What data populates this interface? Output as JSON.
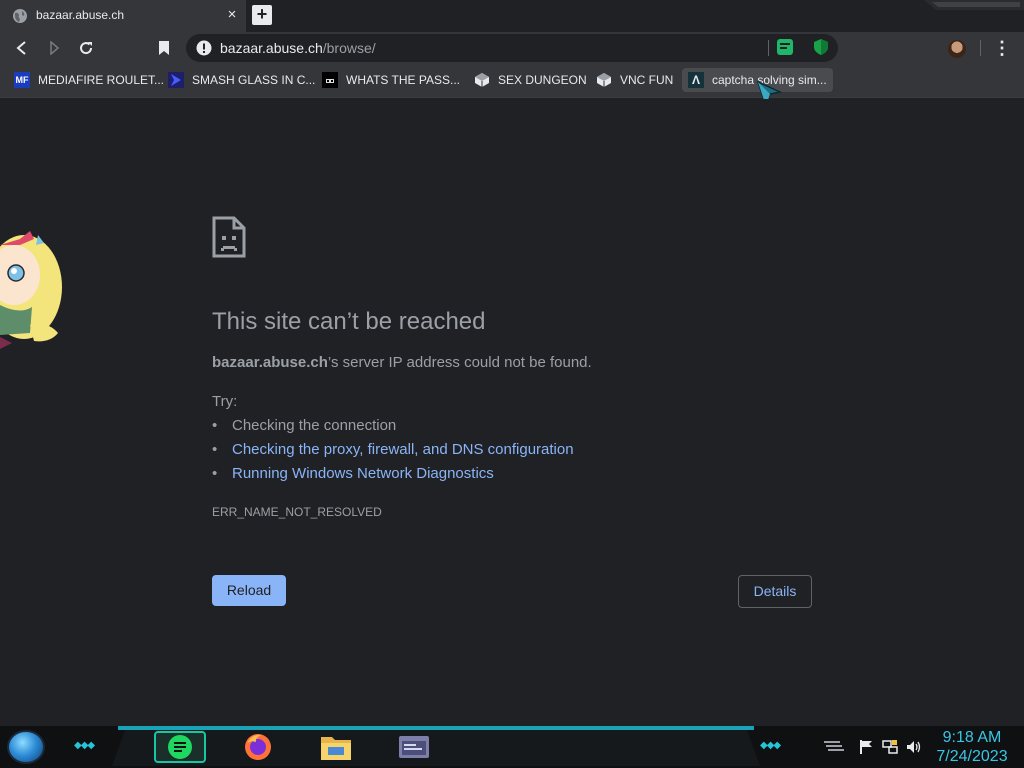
{
  "tab": {
    "title": "bazaar.abuse.ch",
    "close_glyph": "×",
    "new_tab_glyph": "+"
  },
  "toolbar": {
    "url_host": "bazaar.abuse.ch",
    "url_path": "/browse/",
    "menu_glyph": "⋮"
  },
  "bookmarks": [
    {
      "label": "MEDIAFIRE ROULET...",
      "icon": "mediafire-icon",
      "icon_text": "MF"
    },
    {
      "label": "SMASH GLASS IN C...",
      "icon": "chevron-icon"
    },
    {
      "label": "WHATS THE PASS...",
      "icon": "mask-icon"
    },
    {
      "label": "SEX DUNGEON",
      "icon": "cube-icon"
    },
    {
      "label": "VNC FUN",
      "icon": "cube-icon"
    },
    {
      "label": "captcha solving sim...",
      "icon": "lambda-icon",
      "icon_text": "Λ"
    }
  ],
  "error": {
    "title": "This site can’t be reached",
    "host": "bazaar.abuse.ch",
    "message": "’s server IP address could not be found.",
    "try_label": "Try:",
    "suggestions": [
      "Checking the connection",
      "Checking the proxy, firewall, and DNS configuration",
      "Running Windows Network Diagnostics"
    ],
    "code": "ERR_NAME_NOT_RESOLVED",
    "reload_label": "Reload",
    "details_label": "Details"
  },
  "taskbar": {
    "time": "9:18 AM",
    "date": "7/24/2023",
    "apps": [
      "spotify-icon",
      "firefox-icon",
      "file-explorer-icon",
      "window-app-icon"
    ]
  },
  "colors": {
    "link": "#8ab4f8",
    "accent_teal": "#1aa3b8",
    "clock": "#39c6e6"
  }
}
